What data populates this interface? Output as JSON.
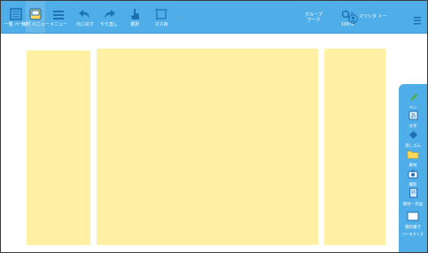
{
  "toolbar": {
    "items": [
      {
        "label": "一覧\nページ",
        "name": "page-list"
      },
      {
        "label": "資料\nメニュー",
        "name": "material-menu"
      },
      {
        "label": "メニュー",
        "name": "menu"
      },
      {
        "label": "元に戻す",
        "name": "undo"
      },
      {
        "label": "やり直し",
        "name": "redo"
      },
      {
        "label": "選択",
        "name": "select"
      },
      {
        "label": "マス目",
        "name": "grid"
      }
    ],
    "group_work": "グループ\nワーク",
    "zoom": "100%",
    "user": "マツシタ トー"
  },
  "palette": {
    "items": [
      {
        "label": "ペン"
      },
      {
        "label": "文字"
      },
      {
        "label": "消しゴム"
      },
      {
        "label": "素材"
      },
      {
        "label": "撮影"
      },
      {
        "label": "教材・作品"
      },
      {
        "label": "資料書き"
      }
    ],
    "footer": "バーをかくす"
  },
  "colors": {
    "toolbar": "#4faee8",
    "block": "#fff0a4",
    "icon": "#1f6fb3",
    "pen": "#4caf2d"
  }
}
